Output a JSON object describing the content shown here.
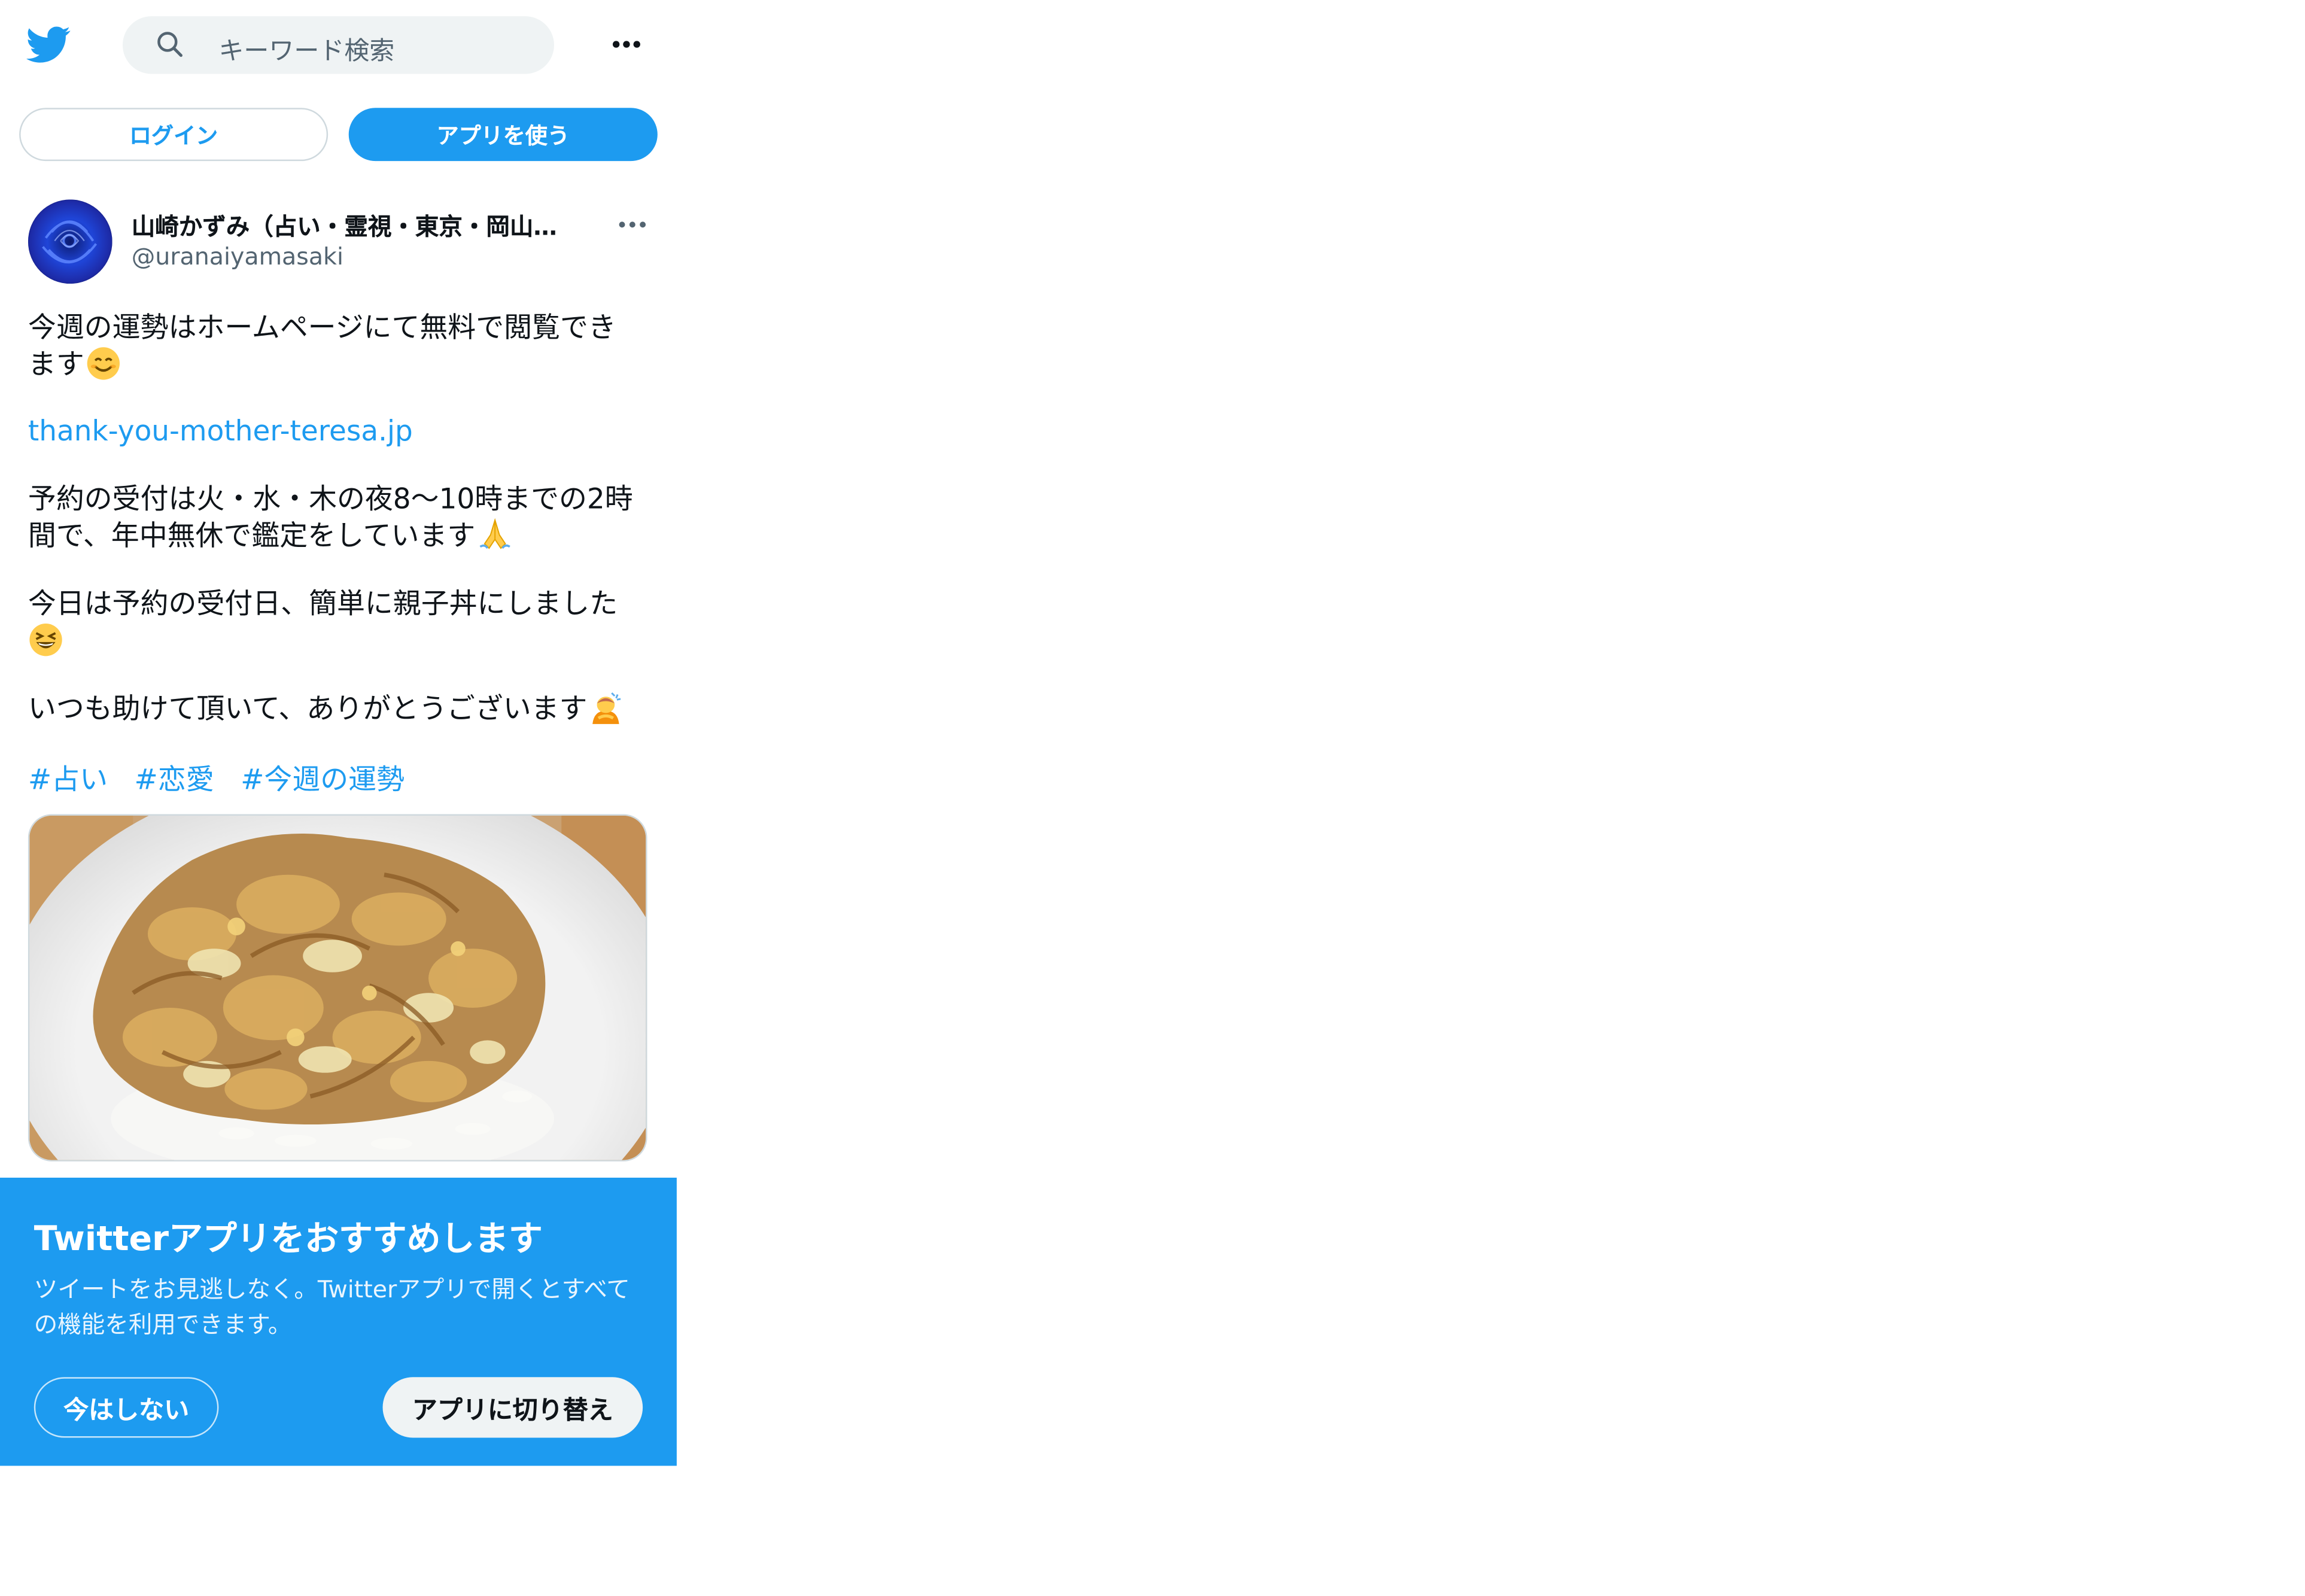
{
  "header": {
    "search_placeholder": "キーワード検索"
  },
  "auth_buttons": {
    "login": "ログイン",
    "use_app": "アプリを使う"
  },
  "tweet": {
    "author_name": "山崎かずみ（占い・霊視・東京・岡山…",
    "author_handle": "@uranaiyamasaki",
    "line1": "今週の運勢はホームページにて無料で閲覧でき",
    "line2": "ます",
    "link": "thank-you-mother-teresa.jp",
    "line3": "予約の受付は火・水・木の夜8〜10時までの2時",
    "line4": "間で、年中無休で鑑定をしています",
    "line5": "今日は予約の受付日、簡単に親子丼にしました",
    "line6": "いつも助けて頂いて、ありがとうございます",
    "hashtags": [
      "#占い",
      "#恋愛",
      "#今週の運勢"
    ]
  },
  "app_banner": {
    "title": "Twitterアプリをおすすめします",
    "description": "ツイートをお見逃しなく。Twitterアプリで開くとすべての機能を利用できます。",
    "not_now": "今はしない",
    "switch": "アプリに切り替え"
  },
  "colors": {
    "accent": "#1d9bf0",
    "text": "#0f1419",
    "secondary": "#536471"
  },
  "icons": [
    "twitter-bird-icon",
    "search-icon",
    "more-icon",
    "smiling-face-emoji",
    "folded-hands-emoji",
    "grinning-squinting-face-emoji",
    "bowing-person-emoji"
  ]
}
